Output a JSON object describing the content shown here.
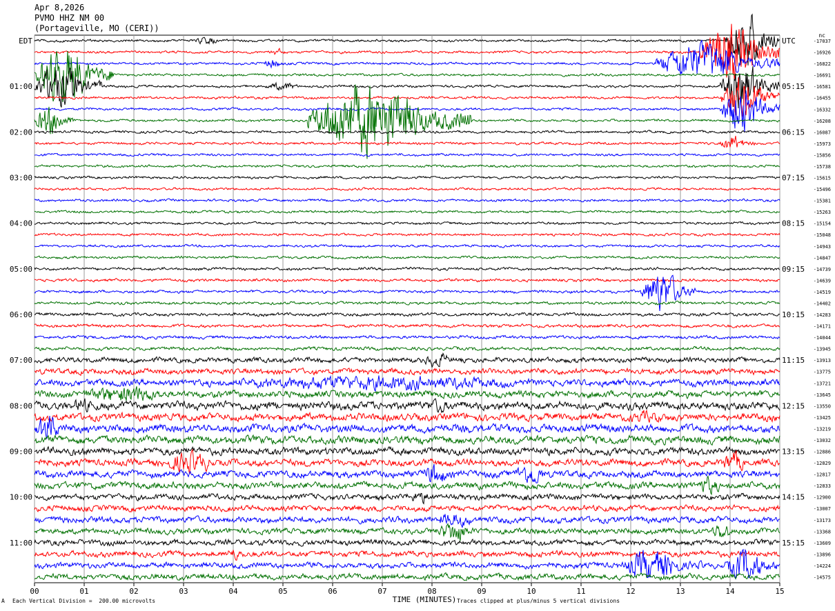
{
  "header": {
    "date": "Apr 8,2026",
    "station": "PVMO HHZ NM 00",
    "location": "(Portageville, MO (CERI))"
  },
  "left_zone": "EDT",
  "right_zone": "UTC",
  "corner_unit": "nc",
  "footer": {
    "scale_note": "Each Vertical Division =  200.00 microvolts",
    "clip_note": "Traces clipped at plus/minus 5 vertical divisions",
    "corner_mark": "A"
  },
  "chart_data": {
    "type": "line",
    "subtype": "helicorder",
    "xlabel": "TIME (MINUTES)",
    "xlim": [
      0,
      15
    ],
    "x_ticks": [
      "00",
      "01",
      "02",
      "03",
      "04",
      "05",
      "06",
      "07",
      "08",
      "09",
      "10",
      "11",
      "12",
      "13",
      "14",
      "15"
    ],
    "line_minutes": 15,
    "line_count": 48,
    "trace_colors": [
      "#000000",
      "#ff0000",
      "#0000ff",
      "#007000"
    ],
    "left_labels": [
      {
        "line": 0,
        "text": "EDT"
      },
      {
        "line": 4,
        "text": "01:00"
      },
      {
        "line": 8,
        "text": "02:00"
      },
      {
        "line": 12,
        "text": "03:00"
      },
      {
        "line": 16,
        "text": "04:00"
      },
      {
        "line": 20,
        "text": "05:00"
      },
      {
        "line": 24,
        "text": "06:00"
      },
      {
        "line": 28,
        "text": "07:00"
      },
      {
        "line": 32,
        "text": "08:00"
      },
      {
        "line": 36,
        "text": "09:00"
      },
      {
        "line": 40,
        "text": "10:00"
      },
      {
        "line": 44,
        "text": "11:00"
      }
    ],
    "right_labels": [
      {
        "line": 0,
        "text": "UTC"
      },
      {
        "line": 4,
        "text": "05:15"
      },
      {
        "line": 8,
        "text": "06:15"
      },
      {
        "line": 12,
        "text": "07:15"
      },
      {
        "line": 16,
        "text": "08:15"
      },
      {
        "line": 20,
        "text": "09:15"
      },
      {
        "line": 24,
        "text": "10:15"
      },
      {
        "line": 28,
        "text": "11:15"
      },
      {
        "line": 32,
        "text": "12:15"
      },
      {
        "line": 36,
        "text": "13:15"
      },
      {
        "line": 40,
        "text": "14:15"
      },
      {
        "line": 44,
        "text": "15:15"
      }
    ],
    "offsets": [
      "-17037",
      "-16926",
      "-16822",
      "-16691",
      "-16581",
      "-16455",
      "-16332",
      "-16208",
      "-16087",
      "-15973",
      "-15856",
      "-15738",
      "-15615",
      "-15496",
      "-15381",
      "-15263",
      "-15154",
      "-15048",
      "-14943",
      "-14847",
      "-14739",
      "-14639",
      "-14519",
      "-14402",
      "-14283",
      "-14171",
      "-14044",
      "-13945",
      "-13913",
      "-13775",
      "-13721",
      "-13645",
      "-13550",
      "-13425",
      "-13219",
      "-13032",
      "-12886",
      "-12829",
      "-12817",
      "-12833",
      "-12900",
      "-13007",
      "-13173",
      "-13368",
      "-13609",
      "-13896",
      "-14224",
      "-14575"
    ],
    "noise": [
      2.2,
      2.2,
      2.2,
      2.2,
      2.2,
      2.2,
      2.2,
      2.2,
      2.2,
      2.2,
      2.2,
      2.2,
      2.2,
      2.2,
      2.2,
      2.2,
      2.2,
      2.2,
      2.2,
      2.2,
      2.5,
      2.5,
      2.5,
      2.5,
      2.8,
      2.8,
      2.8,
      3,
      4.5,
      5,
      6,
      6,
      7,
      6.5,
      7,
      7,
      6.5,
      6,
      6,
      6,
      5,
      5,
      5.5,
      5,
      5,
      5,
      5,
      5
    ],
    "events": [
      {
        "line": 0,
        "start": 3.2,
        "end": 3.9,
        "amp": 8
      },
      {
        "line": 1,
        "start": 4.7,
        "end": 5.2,
        "amp": 7
      },
      {
        "line": 2,
        "start": 4.6,
        "end": 5.1,
        "amp": 10
      },
      {
        "line": 2,
        "start": 12.5,
        "end": 15,
        "amp": 40
      },
      {
        "line": 1,
        "start": 13.4,
        "end": 15,
        "amp": 60
      },
      {
        "line": 0,
        "start": 13.9,
        "end": 15,
        "amp": 60
      },
      {
        "line": 3,
        "start": 0,
        "end": 1.6,
        "amp": 55
      },
      {
        "line": 4,
        "start": 0,
        "end": 1.4,
        "amp": 40
      },
      {
        "line": 4,
        "start": 4.6,
        "end": 5.6,
        "amp": 8
      },
      {
        "line": 4,
        "start": 13.8,
        "end": 15,
        "amp": 45
      },
      {
        "line": 5,
        "start": 13.8,
        "end": 15,
        "amp": 45
      },
      {
        "line": 6,
        "start": 13.8,
        "end": 15,
        "amp": 45
      },
      {
        "line": 7,
        "start": 5.5,
        "end": 8.8,
        "amp": 70
      },
      {
        "line": 7,
        "start": 0,
        "end": 0.8,
        "amp": 30
      },
      {
        "line": 9,
        "start": 13.8,
        "end": 14.5,
        "amp": 15
      },
      {
        "line": 22,
        "start": 12.2,
        "end": 13.3,
        "amp": 40
      },
      {
        "line": 28,
        "start": 7.8,
        "end": 8.6,
        "amp": 15
      },
      {
        "line": 30,
        "start": 3.2,
        "end": 13,
        "amp": 14
      },
      {
        "line": 31,
        "start": 0.8,
        "end": 3.5,
        "amp": 16
      },
      {
        "line": 32,
        "start": 0.7,
        "end": 1.4,
        "amp": 14
      },
      {
        "line": 32,
        "start": 7.8,
        "end": 8.6,
        "amp": 14
      },
      {
        "line": 33,
        "start": 11.8,
        "end": 13.2,
        "amp": 12
      },
      {
        "line": 34,
        "start": 0,
        "end": 0.7,
        "amp": 28
      },
      {
        "line": 37,
        "start": 2.6,
        "end": 4.0,
        "amp": 22
      },
      {
        "line": 37,
        "start": 13.8,
        "end": 14.5,
        "amp": 22
      },
      {
        "line": 38,
        "start": 9.6,
        "end": 10.6,
        "amp": 20
      },
      {
        "line": 38,
        "start": 7.8,
        "end": 8.5,
        "amp": 22
      },
      {
        "line": 39,
        "start": 13.3,
        "end": 14.0,
        "amp": 18
      },
      {
        "line": 40,
        "start": 7.4,
        "end": 8.4,
        "amp": 12
      },
      {
        "line": 42,
        "start": 8.0,
        "end": 9.2,
        "amp": 14
      },
      {
        "line": 43,
        "start": 8.1,
        "end": 9.0,
        "amp": 22
      },
      {
        "line": 43,
        "start": 13.6,
        "end": 14.2,
        "amp": 18
      },
      {
        "line": 45,
        "start": 3.8,
        "end": 4.4,
        "amp": 12
      },
      {
        "line": 46,
        "start": 11.8,
        "end": 13.5,
        "amp": 30
      },
      {
        "line": 46,
        "start": 13.9,
        "end": 15,
        "amp": 32
      }
    ]
  }
}
